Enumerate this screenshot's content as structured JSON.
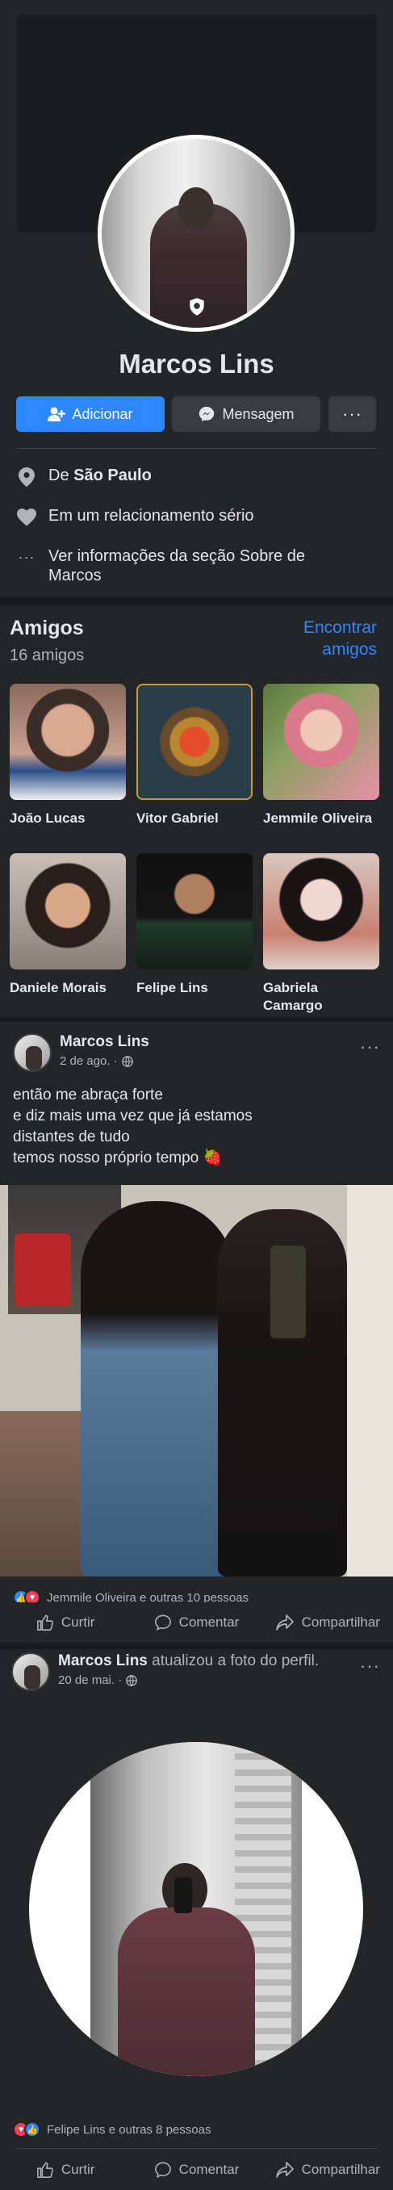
{
  "profile": {
    "name": "Marcos Lins",
    "buttons": {
      "add": "Adicionar",
      "message": "Mensagem",
      "more": "···"
    },
    "info": {
      "city_prefix": "De ",
      "city": "São Paulo",
      "relationship": "Em um relacionamento sério",
      "about": "Ver informações da seção Sobre de Marcos"
    }
  },
  "friends": {
    "title": "Amigos",
    "count": "16 amigos",
    "find": "Encontrar amigos",
    "items": [
      {
        "name": "João Lucas"
      },
      {
        "name": "Vitor Gabriel"
      },
      {
        "name": "Jemmile Oliveira"
      },
      {
        "name": "Daniele Morais"
      },
      {
        "name": "Felipe Lins"
      },
      {
        "name": "Gabriela Camargo"
      }
    ]
  },
  "posts": [
    {
      "author": "Marcos Lins",
      "action": "",
      "time": "2 de ago. ·",
      "more": "···",
      "text_lines": [
        "então me abraça forte",
        "e diz mais uma vez que já estamos",
        "distantes de tudo",
        "temos nosso próprio tempo 🍓"
      ],
      "reactions": "Jemmile Oliveira e outras 10 pessoas",
      "actions": {
        "like": "Curtir",
        "comment": "Comentar",
        "share": "Compartilhar"
      }
    },
    {
      "author": "Marcos Lins",
      "action": " atualizou a foto do perfil.",
      "time": "20 de mai. ·",
      "more": "···",
      "reactions": "Felipe Lins e outras 8 pessoas",
      "actions": {
        "like": "Curtir",
        "comment": "Comentar",
        "share": "Compartilhar"
      }
    }
  ],
  "colors": {
    "accent": "#2d88ff",
    "background": "#18191a",
    "card": "#242526",
    "like": "#2d88ff",
    "love": "#f33e58"
  }
}
